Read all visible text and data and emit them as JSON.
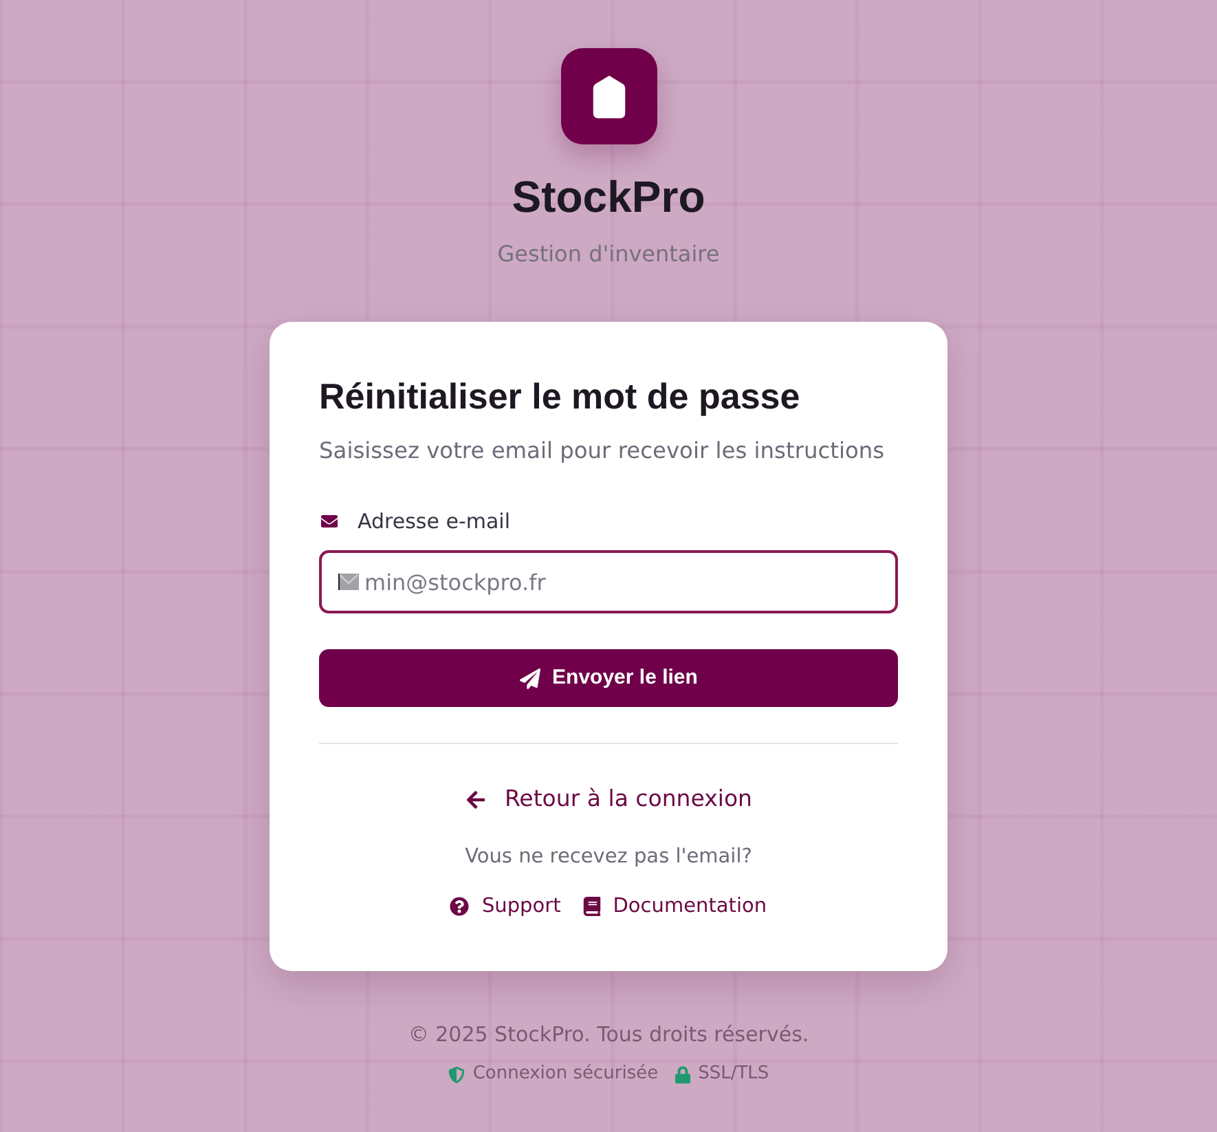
{
  "brand": {
    "name": "StockPro",
    "tagline": "Gestion d'inventaire"
  },
  "card": {
    "title": "Réinitialiser le mot de passe",
    "subtitle": "Saisissez votre email pour recevoir les instructions",
    "email_field": {
      "label": "Adresse e-mail",
      "placeholder": "min@stockpro.fr",
      "focused": true
    },
    "submit_button": "Envoyer le lien",
    "back_link": "Retour à la connexion",
    "help_text": "Vous ne recevez pas l'email?",
    "help_links": [
      {
        "kind": "support",
        "label": "Support"
      },
      {
        "kind": "docs",
        "label": "Documentation"
      }
    ]
  },
  "footer": {
    "copyright": "© 2025 StockPro. Tous droits réservés.",
    "security": [
      {
        "kind": "shield",
        "label": "Connexion sécurisée"
      },
      {
        "kind": "lock",
        "label": "SSL/TLS"
      }
    ]
  }
}
